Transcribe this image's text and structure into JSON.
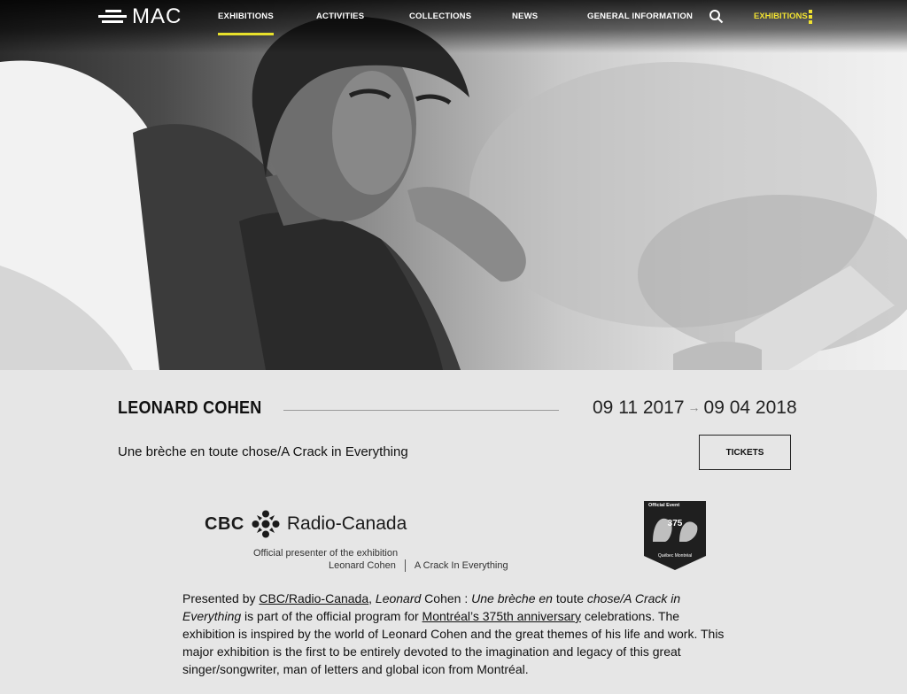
{
  "header": {
    "logo_text": "MAC",
    "nav": [
      {
        "label": "EXHIBITIONS",
        "active": true
      },
      {
        "label": "ACTIVITIES",
        "active": false
      },
      {
        "label": "COLLECTIONS",
        "active": false
      },
      {
        "label": "NEWS",
        "active": false
      },
      {
        "label": "GENERAL INFORMATION",
        "active": false
      }
    ],
    "right_label": "EXHIBITIONS",
    "accent_color": "#e8e12b"
  },
  "exhibition": {
    "title": "LEONARD COHEN",
    "start_date": "09 11 2017",
    "date_arrow": "→",
    "end_date": "09 04 2018",
    "subtitle": "Une brèche en toute chose/A Crack in Everything",
    "tickets_label": "TICKETS"
  },
  "sponsor": {
    "name1": "CBC",
    "name2": "Radio-Canada",
    "official_line1": "Official presenter of the exhibition",
    "official_artist": "Leonard Cohen",
    "official_title": "A Crack In Everything",
    "badge_top": "Official Event",
    "badge_mid": "375",
    "badge_footer": "Québec  Montréal"
  },
  "description": {
    "intro": "Presented by ",
    "link1": "CBC/Radio-Canada",
    "sep1": ", ",
    "italic1": "Leonard",
    "mid1": " Cohen : ",
    "italic2": "Une brèche en",
    "mid2": " toute ",
    "italic3": "chose/A Crack in Everything",
    "part2": " is part of the official program for ",
    "link2": "Montréal’s 375th anniversary",
    "part3": " celebrations. The exhibition is inspired by the world of Leonard Cohen and the great themes of his life and work. This major exhibition is the first to be entirely devoted to the imagination and legacy of this great singer/songwriter, man of letters and global icon from Montréal."
  }
}
